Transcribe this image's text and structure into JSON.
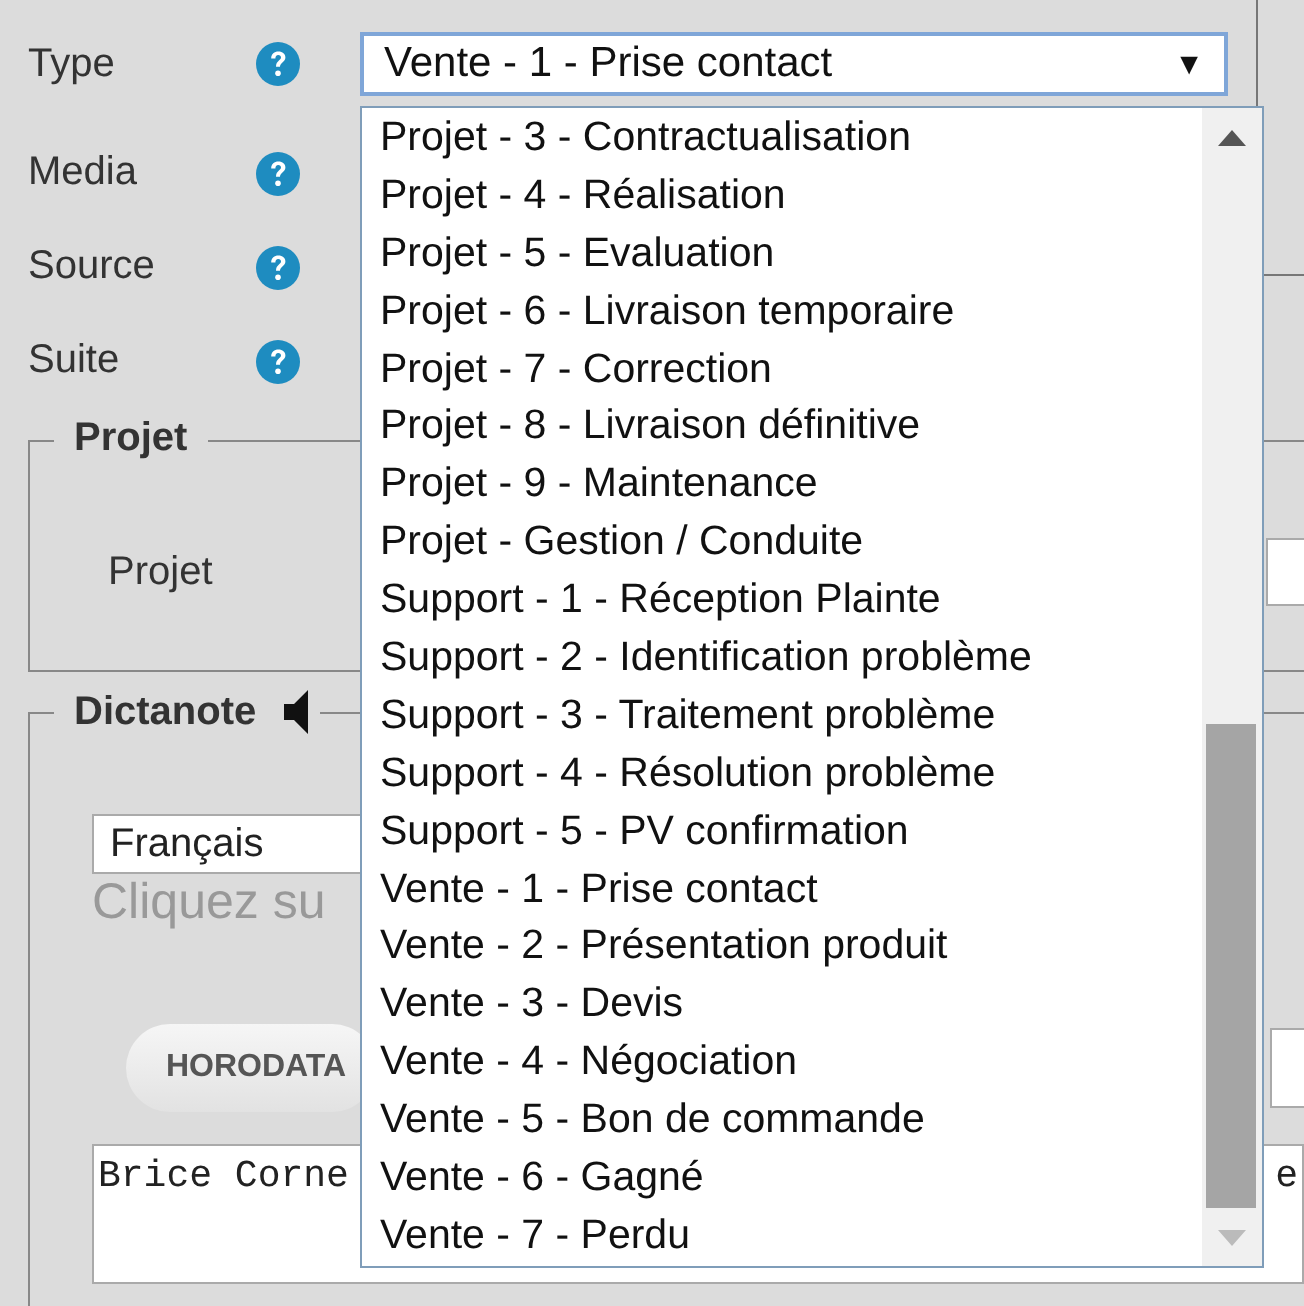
{
  "fields": [
    {
      "label": "Type"
    },
    {
      "label": "Media"
    },
    {
      "label": "Source"
    },
    {
      "label": "Suite"
    }
  ],
  "type_select": {
    "value": "Vente - 1 - Prise contact",
    "arrow": "▼"
  },
  "dropdown": {
    "options": [
      "Projet - 3 - Contractualisation",
      "Projet - 4 - Réalisation",
      "Projet - 5 - Evaluation",
      "Projet - 6 - Livraison temporaire",
      "Projet - 7 - Correction",
      "Projet - 8 - Livraison définitive",
      "Projet - 9 - Maintenance",
      "Projet - Gestion / Conduite",
      "Support - 1 - Réception Plainte",
      "Support - 2 - Identification problème",
      "Support - 3 - Traitement problème",
      "Support - 4 - Résolution problème",
      "Support - 5 - PV confirmation",
      "Vente - 1 - Prise contact",
      "Vente - 2 - Présentation produit",
      "Vente - 3 - Devis",
      "Vente - 4 - Négociation",
      "Vente - 5 - Bon de commande",
      "Vente - 6 - Gagné",
      "Vente - 7 - Perdu"
    ]
  },
  "projet_section": {
    "legend": "Projet",
    "label": "Projet"
  },
  "dictanote_section": {
    "legend": "Dictanote",
    "language": "Français",
    "hint": "Cliquez su",
    "button": "HORODATA",
    "text": "Brice Corne",
    "text_end": "e"
  }
}
